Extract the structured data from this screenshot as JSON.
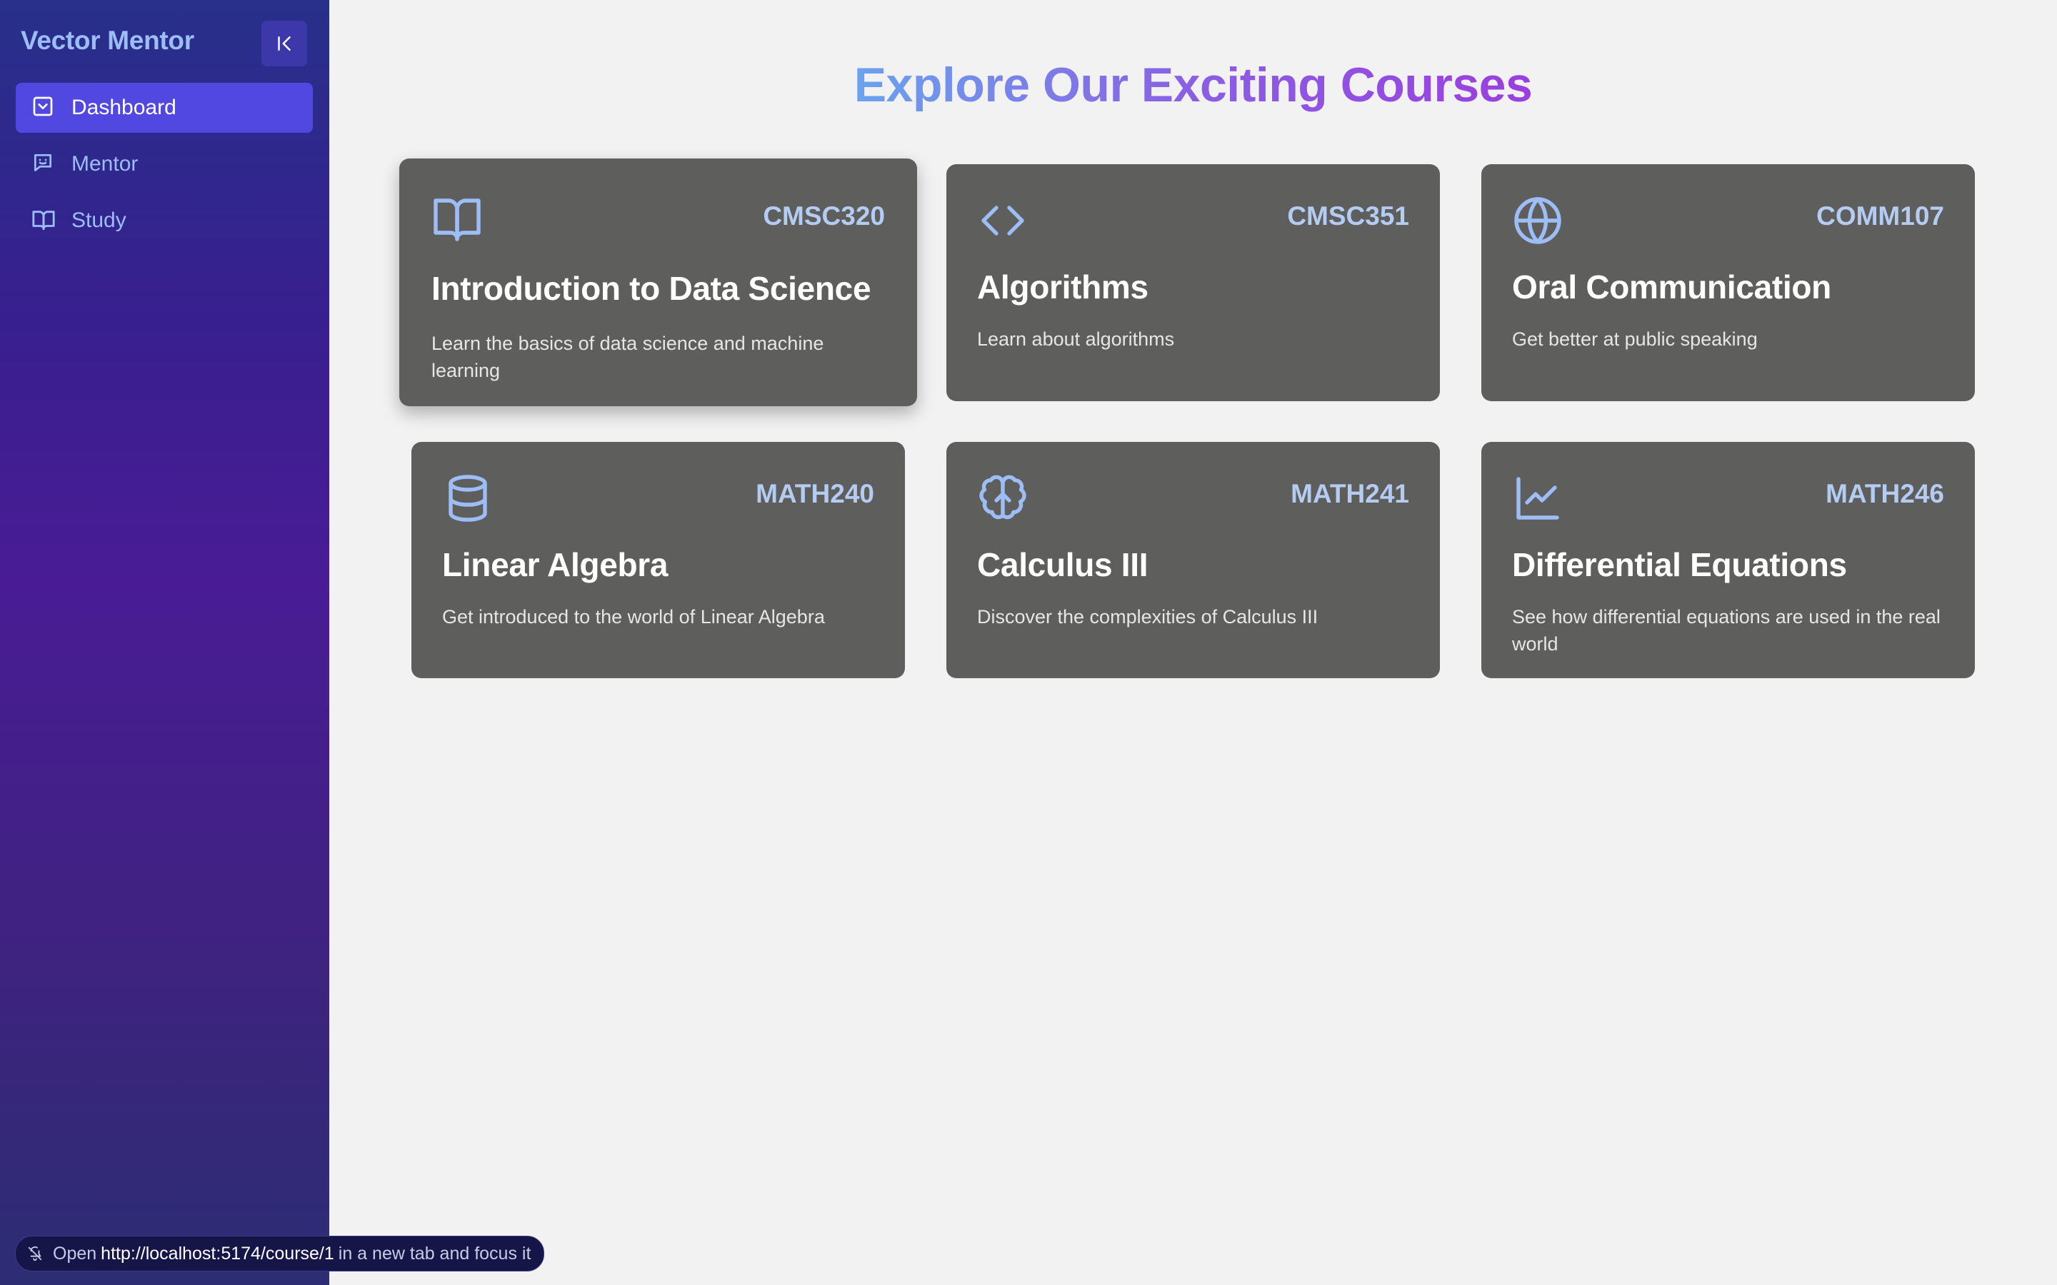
{
  "app": {
    "name": "Vector Mentor"
  },
  "sidebar": {
    "items": [
      {
        "label": "Dashboard",
        "icon": "dashboard-icon",
        "active": true
      },
      {
        "label": "Mentor",
        "icon": "chat-icon",
        "active": false
      },
      {
        "label": "Study",
        "icon": "book-icon",
        "active": false
      }
    ]
  },
  "main": {
    "heading": "Explore Our Exciting Courses",
    "courses": [
      {
        "code": "CMSC320",
        "title": "Introduction to Data Science",
        "description": "Learn the basics of data science and machine learning",
        "icon": "book-open-icon"
      },
      {
        "code": "CMSC351",
        "title": "Algorithms",
        "description": "Learn about algorithms",
        "icon": "code-icon"
      },
      {
        "code": "COMM107",
        "title": "Oral Communication",
        "description": "Get better at public speaking",
        "icon": "globe-icon"
      },
      {
        "code": "MATH240",
        "title": "Linear Algebra",
        "description": "Get introduced to the world of Linear Algebra",
        "icon": "database-icon"
      },
      {
        "code": "MATH241",
        "title": "Calculus III",
        "description": "Discover the complexities of Calculus III",
        "icon": "brain-icon"
      },
      {
        "code": "MATH246",
        "title": "Differential Equations",
        "description": "See how differential equations are used in the real world",
        "icon": "line-chart-icon"
      }
    ]
  },
  "statusbar": {
    "prefix": "Open",
    "url": "http://localhost:5174/course/1",
    "suffix": "in a new tab and focus it"
  },
  "colors": {
    "accent": "#5048e0",
    "card": "#5e5e5d",
    "icon": "#9dbdf7"
  }
}
